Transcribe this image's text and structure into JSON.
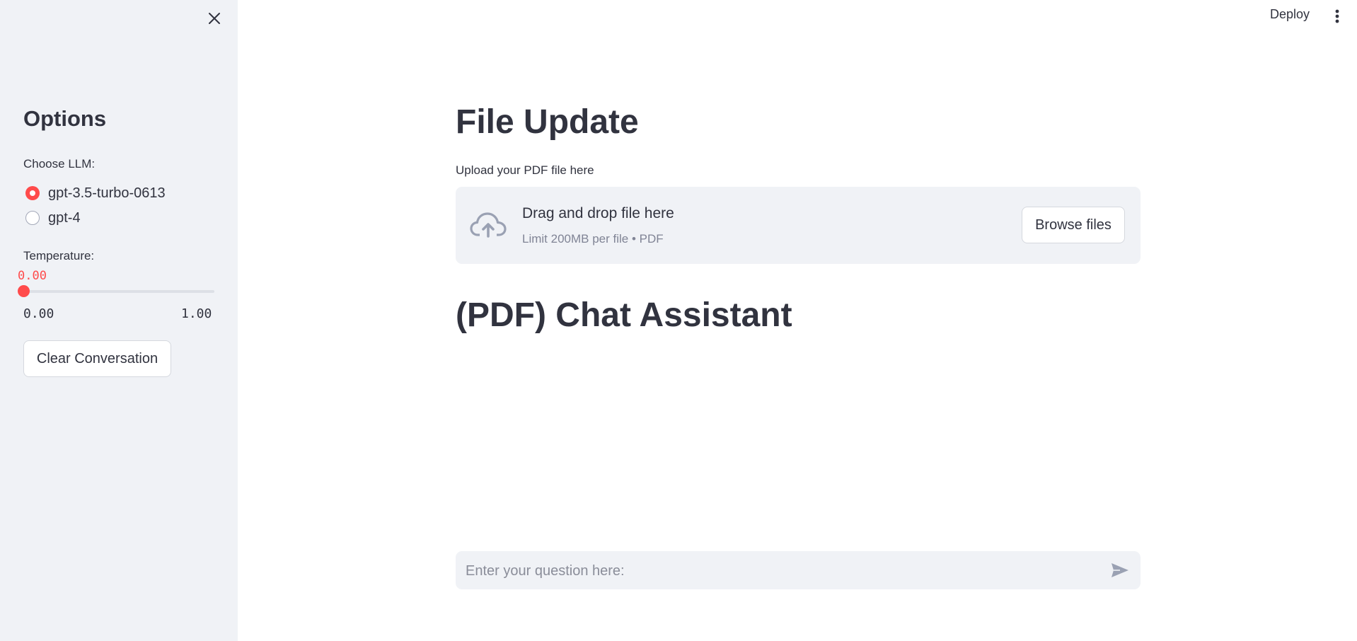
{
  "sidebar": {
    "title": "Options",
    "llm_label": "Choose LLM:",
    "llm_options": [
      {
        "label": "gpt-3.5-turbo-0613",
        "selected": true
      },
      {
        "label": "gpt-4",
        "selected": false
      }
    ],
    "temperature": {
      "label": "Temperature:",
      "value": 0.0,
      "value_text": "0.00",
      "min_text": "0.00",
      "max_text": "1.00"
    },
    "clear_button": "Clear Conversation"
  },
  "header": {
    "deploy_label": "Deploy"
  },
  "main": {
    "file_title": "File Update",
    "upload_label": "Upload your PDF file here",
    "dropzone_title": "Drag and drop file here",
    "dropzone_limit": "Limit 200MB per file • PDF",
    "browse_button": "Browse files",
    "chat_title": "(PDF) Chat Assistant",
    "chat_placeholder": "Enter your question here:"
  },
  "colors": {
    "accent": "#ff4b4b",
    "sidebar_bg": "#f0f2f6",
    "text": "#31333f"
  },
  "icons": [
    "close-icon",
    "menu-dots-icon",
    "cloud-upload-icon",
    "send-icon"
  ]
}
